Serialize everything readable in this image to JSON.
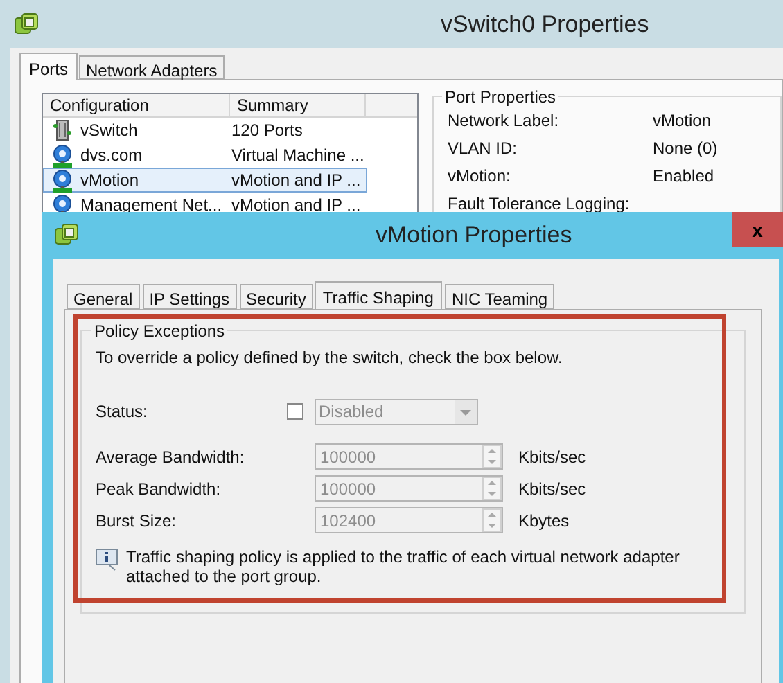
{
  "back_window": {
    "title": "vSwitch0 Properties",
    "tabs": [
      {
        "label": "Ports",
        "selected": true
      },
      {
        "label": "Network Adapters",
        "selected": false
      }
    ],
    "list": {
      "columns": [
        "Configuration",
        "Summary"
      ],
      "rows": [
        {
          "kind": "switch",
          "configuration": "vSwitch",
          "summary": "120 Ports",
          "selected": false
        },
        {
          "kind": "port",
          "configuration": "dvs.com",
          "summary": "Virtual Machine ...",
          "selected": false
        },
        {
          "kind": "port",
          "configuration": "vMotion",
          "summary": "vMotion and IP ...",
          "selected": true
        },
        {
          "kind": "port",
          "configuration": "Management Net...",
          "summary": "vMotion and IP ...",
          "selected": false
        }
      ]
    },
    "port_properties": {
      "title": "Port Properties",
      "fields": [
        {
          "label": "Network Label:",
          "value": "vMotion"
        },
        {
          "label": "VLAN ID:",
          "value": "None (0)"
        },
        {
          "label": "vMotion:",
          "value": "Enabled"
        },
        {
          "label": "Fault Tolerance Logging:"
        }
      ]
    }
  },
  "dialog": {
    "title": "vMotion Properties",
    "close": "x",
    "tabs": [
      {
        "label": "General",
        "selected": false
      },
      {
        "label": "IP Settings",
        "selected": false
      },
      {
        "label": "Security",
        "selected": false
      },
      {
        "label": "Traffic Shaping",
        "selected": true
      },
      {
        "label": "NIC Teaming",
        "selected": false
      }
    ],
    "group_title": "Policy Exceptions",
    "instruction": "To override a policy defined by the switch, check the box below.",
    "status": {
      "label": "Status:",
      "checked": false,
      "value": "Disabled",
      "disabled": true
    },
    "fields": [
      {
        "label": "Average Bandwidth:",
        "value": "100000",
        "unit": "Kbits/sec",
        "disabled": true
      },
      {
        "label": "Peak Bandwidth:",
        "value": "100000",
        "unit": "Kbits/sec",
        "disabled": true
      },
      {
        "label": "Burst Size:",
        "value": "102400",
        "unit": "Kbytes",
        "disabled": true
      }
    ],
    "info": "Traffic shaping policy is applied to the traffic of each virtual network adapter attached to the port group."
  }
}
